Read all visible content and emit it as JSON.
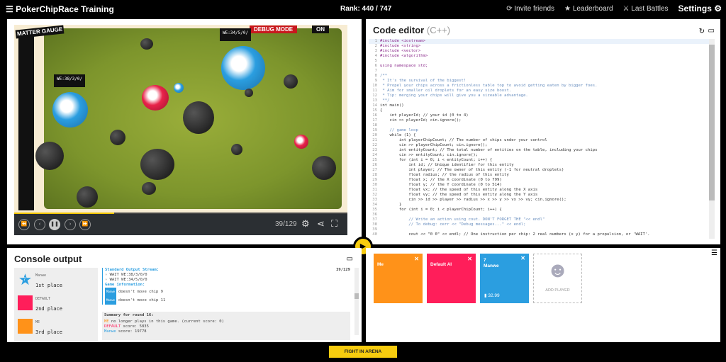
{
  "topbar": {
    "menu_icon": "hamburger-icon",
    "title": "PokerChipRace Training",
    "rank": "Rank: 440 / 747",
    "invite": "Invite friends",
    "leaderboard": "Leaderboard",
    "last_battles": "Last Battles",
    "settings": "Settings"
  },
  "game": {
    "gauge_label": "MATTER GAUGE",
    "debug": "DEBUG MODE",
    "debug_state": "ON",
    "tag1": "WE:38/3/0/",
    "tag2": "WE:34/5/0/",
    "frame": "39/129",
    "progress": 0.3
  },
  "editor": {
    "title": "Code editor",
    "lang": "(C++)",
    "lines": [
      "#include <iostream>",
      "#include <string>",
      "#include <vector>",
      "#include <algorithm>",
      "",
      "using namespace std;",
      "",
      "/**",
      " * It's the survival of the biggest!",
      " * Propel your chips across a frictionless table top to avoid getting eaten by bigger foes.",
      " * Aim for smaller oil droplets for an easy size boost.",
      " * Tip: merging your chips will give you a sizeable advantage.",
      " **/",
      "int main()",
      "{",
      "    int playerId; // your id (0 to 4)",
      "    cin >> playerId; cin.ignore();",
      "",
      "    // game loop",
      "    while (1) {",
      "        int playerChipCount; // The number of chips under your control",
      "        cin >> playerChipCount; cin.ignore();",
      "        int entityCount; // The total number of entities on the table, including your chips",
      "        cin >> entityCount; cin.ignore();",
      "        for (int i = 0; i < entityCount; i++) {",
      "            int id; // Unique identifier for this entity",
      "            int player; // The owner of this entity (-1 for neutral droplets)",
      "            float radius; // the radius of this entity",
      "            float x; // the X coordinate (0 to 799)",
      "            float y; // the Y coordinate (0 to 514)",
      "            float vx; // the speed of this entity along the X axis",
      "            float vy; // the speed of this entity along the Y axis",
      "            cin >> id >> player >> radius >> x >> y >> vx >> vy; cin.ignore();",
      "        }",
      "        for (int i = 0; i < playerChipCount; i++) {",
      "",
      "            // Write an action using cout. DON'T FORGET THE \"<< endl\"",
      "            // To debug: cerr << \"Debug messages...\" << endl;",
      "",
      "            cout << \"0 0\" << endl; // One instruction per chip: 2 real numbers (x y) for a propulsion, or 'WAIT'."
    ]
  },
  "console": {
    "title": "Console output",
    "frame": "39/129",
    "ranking": [
      {
        "name": "Manwe",
        "place": "1st place",
        "rank_badge": "7",
        "color": "#2b9ee0"
      },
      {
        "name": "DEFAULT",
        "place": "2nd place",
        "color": "#ff1e5a"
      },
      {
        "name": "ME",
        "place": "3rd place",
        "color": "#ff9219"
      }
    ],
    "stdout_header": "Standard Output Stream:",
    "stdout": [
      "WAIT WE:38/3/0/0",
      "WAIT WE:34/5/0/0"
    ],
    "game_info_header": "Game information:",
    "game_info": [
      {
        "badge": "Manwe",
        "text": "doesn't move chip 9"
      },
      {
        "badge": "Manwe",
        "text": "doesn't move chip 11"
      }
    ],
    "summary_header": "Summary for round 16:",
    "summary": [
      {
        "who": "ME",
        "text": " no longer plays in this game. (current score: 0)",
        "color": "#ff9219"
      },
      {
        "who": "DEFAULT",
        "text": " score: 5835",
        "color": "#ff1e5a"
      },
      {
        "who": "Manwe",
        "text": " score: 19778",
        "color": "#2b9ee0"
      }
    ]
  },
  "players": {
    "cards": [
      {
        "name": "Me",
        "color": "#ff9219"
      },
      {
        "name": "Default AI",
        "color": "#ff1e5a"
      },
      {
        "rank": "7",
        "name": "Manwe",
        "score": "32.99",
        "color": "#2b9ee0"
      }
    ],
    "add_label": "ADD PLAYER"
  },
  "fight_label": "FIGHT IN ARENA"
}
